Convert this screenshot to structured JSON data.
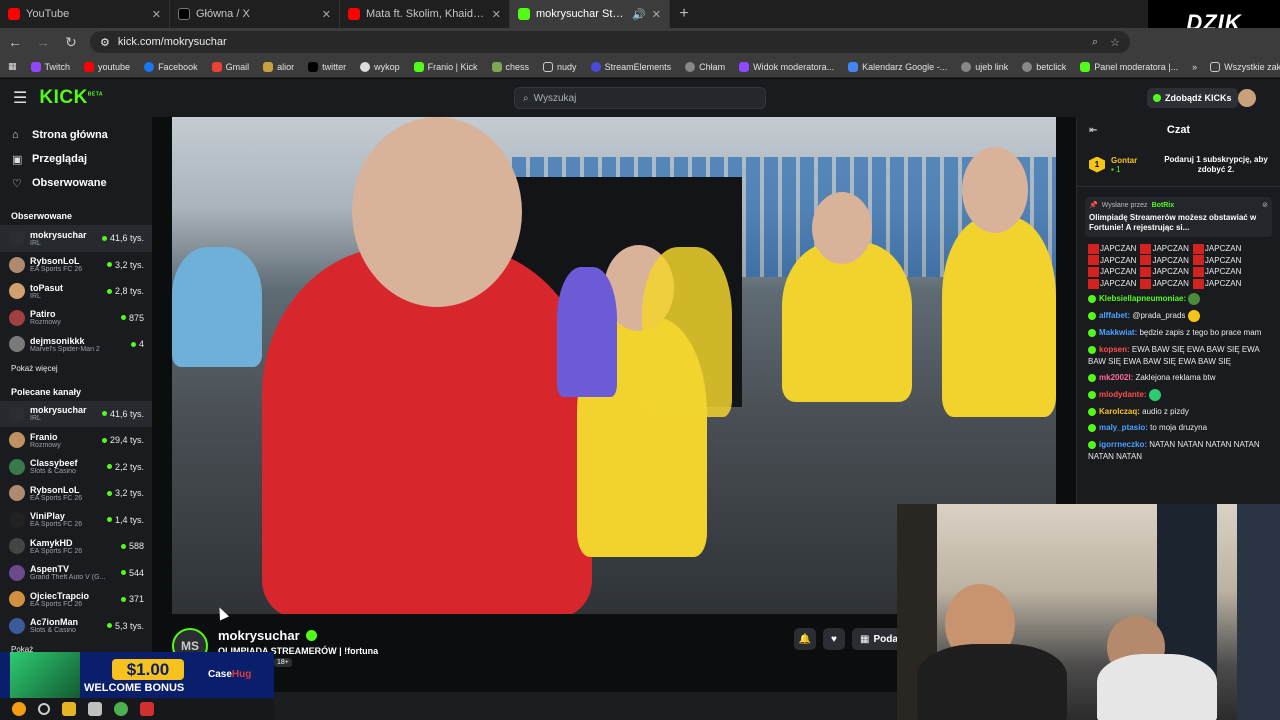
{
  "browser": {
    "tabs": [
      {
        "label": "YouTube",
        "favicon_color": "#ff0000",
        "active": false
      },
      {
        "label": "Główna / X",
        "favicon_color": "#000000",
        "active": false
      },
      {
        "label": "Mata ft. Skolim, Khaid - KAMIKAZE",
        "favicon_color": "#ff0000",
        "active": false
      },
      {
        "label": "mokrysuchar Stream - Watch",
        "favicon_color": "#53fc18",
        "active": true
      }
    ],
    "url": "kick.com/mokrysuchar",
    "bookmarks": [
      "Twitch",
      "youtube",
      "Facebook",
      "Gmail",
      "alior",
      "twitter",
      "wykop",
      "Franio | Kick",
      "chess",
      "nudy",
      "StreamElements",
      "Chłam",
      "Widok moderatora...",
      "Kalendarz Google -...",
      "ujeb link",
      "betclick",
      "Panel moderatora |..."
    ],
    "all_bookmarks": "Wszystkie zakładki",
    "overlay_logo": "DZIK"
  },
  "header": {
    "logo": "KICK",
    "logo_sup": "BETA",
    "search_placeholder": "Wyszukaj",
    "kicks_button": "Zdobądź KICKs"
  },
  "sidebar": {
    "nav": [
      {
        "label": "Strona główna",
        "icon": "home-icon"
      },
      {
        "label": "Przeglądaj",
        "icon": "browse-icon"
      },
      {
        "label": "Obserwowane",
        "icon": "heart-icon"
      }
    ],
    "followed_title": "Obserwowane",
    "followed": [
      {
        "name": "mokrysuchar",
        "category": "IRL",
        "viewers": "41,6 tys.",
        "color": "#2a2d31",
        "selected": true
      },
      {
        "name": "RybsonLoL",
        "category": "EA Sports FC 26",
        "viewers": "3,2 tys.",
        "color": "#b08a6e"
      },
      {
        "name": "toPasut",
        "category": "IRL",
        "viewers": "2,8 tys.",
        "color": "#d0a070"
      },
      {
        "name": "Patiro",
        "category": "Rozmowy",
        "viewers": "875",
        "color": "#a04040"
      },
      {
        "name": "dejmsonikkk",
        "category": "Marvel's Spider-Man 2",
        "viewers": "4",
        "color": "#7a7a7a"
      }
    ],
    "show_more": "Pokaż więcej",
    "recommended_title": "Polecane kanały",
    "recommended": [
      {
        "name": "mokrysuchar",
        "category": "IRL",
        "viewers": "41,6 tys.",
        "color": "#2a2d31",
        "selected": true
      },
      {
        "name": "Franio",
        "category": "Rozmowy",
        "viewers": "29,4 tys.",
        "color": "#c09060"
      },
      {
        "name": "Classybeef",
        "category": "Slots & Casino",
        "viewers": "2,2 tys.",
        "color": "#3a7a4a"
      },
      {
        "name": "RybsonLoL",
        "category": "EA Sports FC 26",
        "viewers": "3,2 tys.",
        "color": "#b08a6e"
      },
      {
        "name": "ViniPlay",
        "category": "EA Sports FC 26",
        "viewers": "1,4 tys.",
        "color": "#222222"
      },
      {
        "name": "KamykHD",
        "category": "EA Sports FC 26",
        "viewers": "588",
        "color": "#444444"
      },
      {
        "name": "AspenTV",
        "category": "Grand Theft Auto V (G...",
        "viewers": "544",
        "color": "#6a4a8a"
      },
      {
        "name": "OjciecTrapcio",
        "category": "EA Sports FC 26",
        "viewers": "371",
        "color": "#d09040"
      },
      {
        "name": "Ac7ionMan",
        "category": "Slots & Casino",
        "viewers": "5,3 tys.",
        "color": "#3a5a9a"
      }
    ],
    "show_more_bottom": "Pokaż"
  },
  "stream": {
    "avatar_text": "MS",
    "channel": "mokrysuchar",
    "title": "OLIMPIADA STREAMERÓW | !fortuna",
    "age_tag": "18+",
    "gift_label": "Podar"
  },
  "chat": {
    "title": "Czat",
    "gifter": {
      "rank": "1",
      "name": "Gontar",
      "subs": "1",
      "cta": "Podaruj 1 subskrypcję, aby zdobyć 2."
    },
    "pinned_by": "Wysłane przez",
    "pinned_user": "BotRix",
    "pinned_msg": "Olimpiadę Streamerów możesz obstawiać w Fortunie! A rejestrując si...",
    "jap_word": "JAPCZAN",
    "messages": [
      {
        "user": "Klebsiellapneumoniae:",
        "color": "#53fc18",
        "text": ""
      },
      {
        "user": "alffabet:",
        "color": "#4aa3ff",
        "text": " @prada_prads"
      },
      {
        "user": "Makkwiat:",
        "color": "#4aa3ff",
        "text": " będzie zapis z tego bo prace mam"
      },
      {
        "user": "kopsen:",
        "color": "#ff4d4d",
        "text": " EWA BAW SIĘ  EWA BAW SIĘ  EWA BAW SIĘ  EWA BAW SIĘ  EWA BAW SIĘ"
      },
      {
        "user": "mk2002l:",
        "color": "#ff6b9a",
        "text": " Zaklejona reklama btw"
      },
      {
        "user": "mlodydante:",
        "color": "#ff4d4d",
        "text": ""
      },
      {
        "user": "Karolczaq:",
        "color": "#f5c518",
        "text": " audio z pizdy"
      },
      {
        "user": "maly_ptasio:",
        "color": "#4aa3ff",
        "text": " to moja druzyna"
      },
      {
        "user": "igorrneczko:",
        "color": "#4aa3ff",
        "text": " NATAN  NATAN  NATAN  NATAN  NATAN  NATAN"
      }
    ]
  },
  "ad": {
    "amount": "$1.00",
    "bonus": "WELCOME BONUS",
    "brand_a": "Case",
    "brand_b": "Hug"
  }
}
